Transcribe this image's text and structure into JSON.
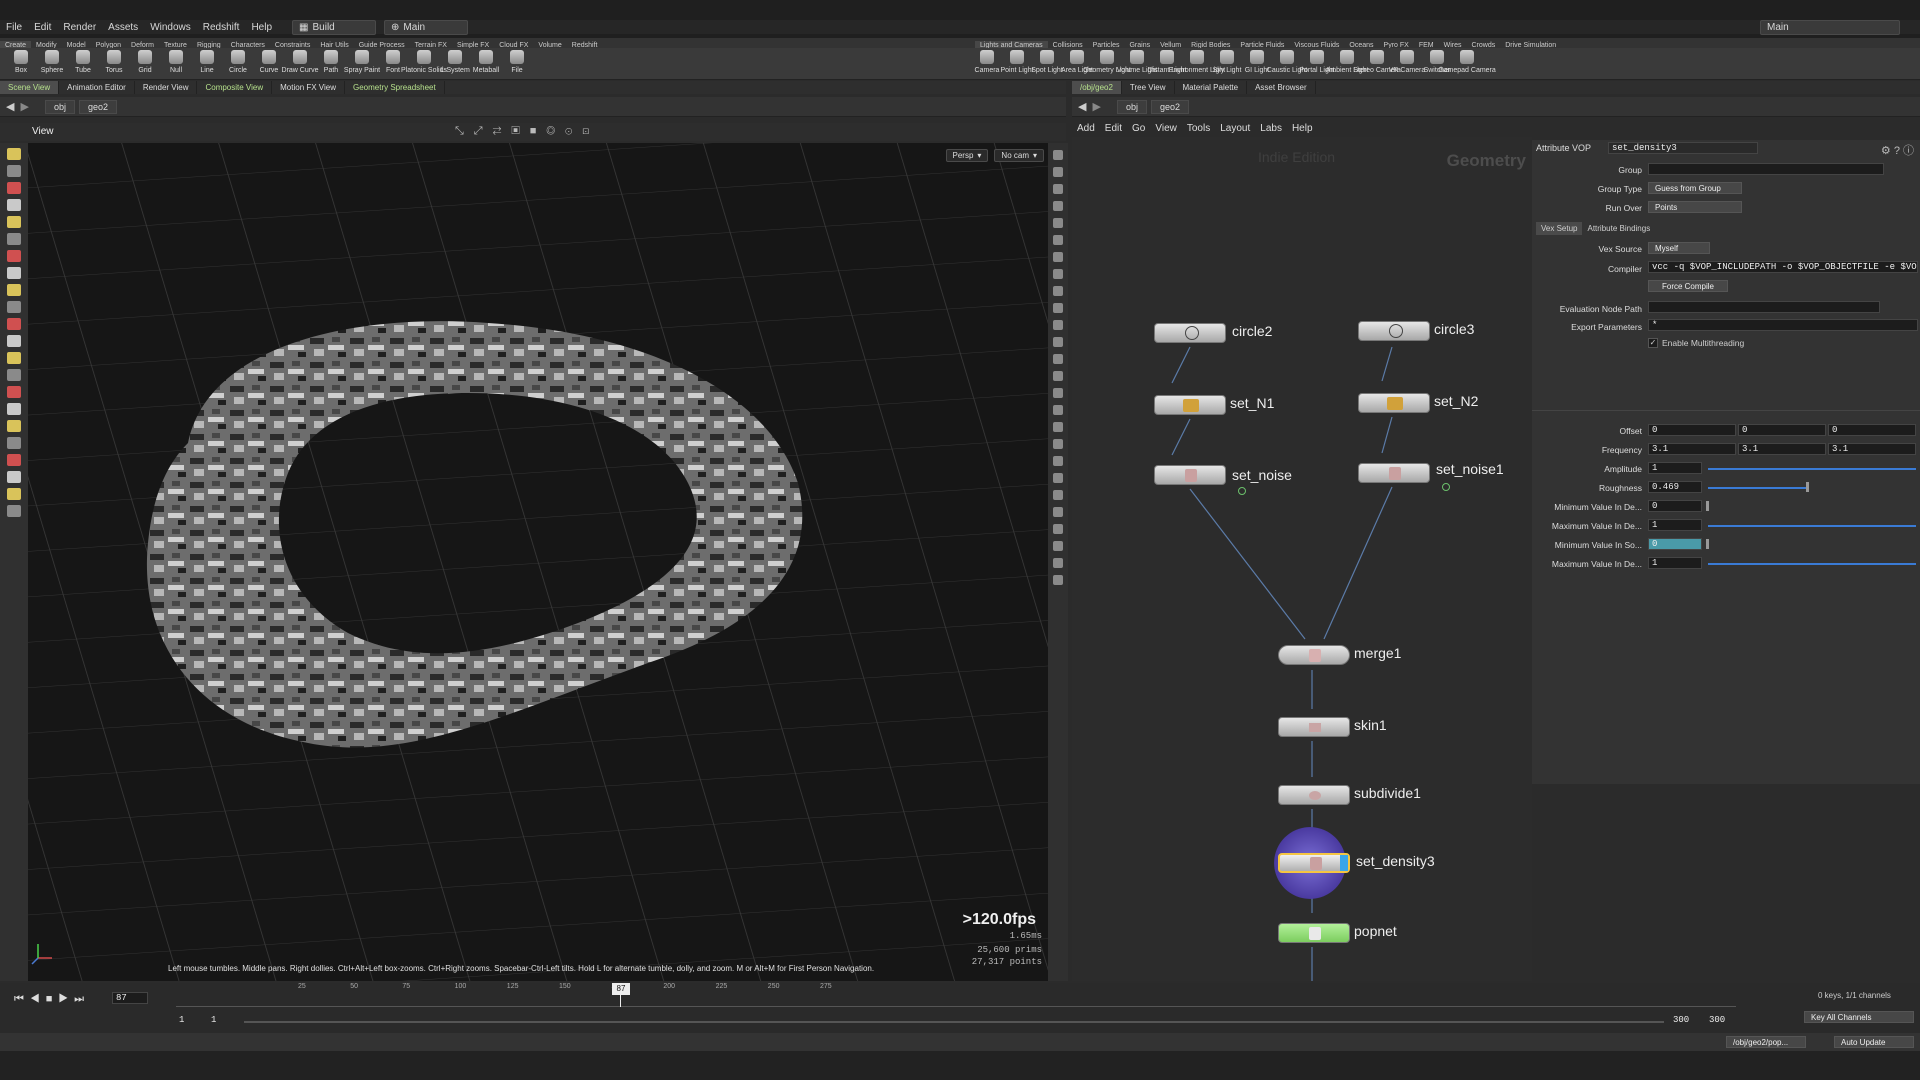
{
  "menu": {
    "items": [
      "File",
      "Edit",
      "Render",
      "Assets",
      "Windows",
      "Redshift",
      "Help"
    ],
    "desktop": "Build",
    "context": "Main",
    "main_right": "Main"
  },
  "shelf_tabs_left": [
    "Create",
    "Modify",
    "Model",
    "Polygon",
    "Deform",
    "Texture",
    "Rigging",
    "Characters",
    "Constraints",
    "Hair Utils",
    "Guide Process",
    "Terrain FX",
    "Simple FX",
    "Cloud FX",
    "Volume",
    "Redshift"
  ],
  "shelf_tabs_right": [
    "Lights and Cameras",
    "Collisions",
    "Particles",
    "Grains",
    "Vellum",
    "Rigid Bodies",
    "Particle Fluids",
    "Viscous Fluids",
    "Oceans",
    "Pyro FX",
    "FEM",
    "Wires",
    "Crowds",
    "Drive Simulation"
  ],
  "tools_left": [
    "Box",
    "Sphere",
    "Tube",
    "Torus",
    "Grid",
    "Null",
    "Line",
    "Circle",
    "Curve",
    "Draw Curve",
    "Path",
    "Spray Paint",
    "Font",
    "Platonic Solids",
    "L-System",
    "Metaball",
    "File"
  ],
  "tools_right": [
    "Camera",
    "Point Light",
    "Spot Light",
    "Area Light",
    "Geometry Light",
    "Volume Light",
    "Distant Light",
    "Environment Light",
    "Sky Light",
    "GI Light",
    "Caustic Light",
    "Portal Light",
    "Ambient Light",
    "Stereo Camera",
    "VR Camera",
    "Switcher",
    "Gamepad Camera"
  ],
  "left_pane_tabs": [
    "Scene View",
    "Animation Editor",
    "Render View",
    "Composite View",
    "Motion FX View",
    "Geometry Spreadsheet"
  ],
  "right_pane_tabs": [
    "/obj/geo2",
    "Tree View",
    "Material Palette",
    "Asset Browser"
  ],
  "left_path": [
    "obj",
    "geo2"
  ],
  "right_path": [
    "obj",
    "geo2"
  ],
  "viewport": {
    "title": "View",
    "persp": "Persp",
    "cam": "No cam",
    "fps": ">120.0fps",
    "ms": "1.65ms",
    "prims": "25,600  prims",
    "points": "27,317  points",
    "help": "Left mouse tumbles. Middle pans. Right dollies. Ctrl+Alt+Left box-zooms. Ctrl+Right zooms. Spacebar-Ctrl-Left tilts. Hold L for alternate tumble, dolly, and zoom.    M or Alt+M for First Person Navigation."
  },
  "network": {
    "menu": [
      "Add",
      "Edit",
      "Go",
      "View",
      "Tools",
      "Layout",
      "Labs",
      "Help"
    ],
    "watermark": "Indie Edition",
    "context": "Geometry",
    "nodes": {
      "circle2": "circle2",
      "circle3": "circle3",
      "set_N1": "set_N1",
      "set_N2": "set_N2",
      "set_noise": "set_noise",
      "set_noise1": "set_noise1",
      "merge1": "merge1",
      "skin1": "skin1",
      "subdivide1": "subdivide1",
      "set_density3": "set_density3",
      "popnet": "popnet"
    }
  },
  "params": {
    "node_type": "Attribute VOP",
    "node_name": "set_density3",
    "group_label": "Group",
    "group_value": "",
    "group_type_label": "Group Type",
    "group_type": "Guess from Group",
    "run_over_label": "Run Over",
    "run_over": "Points",
    "tabs": [
      "Vex Setup",
      "Attribute Bindings"
    ],
    "vex_source_label": "Vex Source",
    "vex_source": "Myself",
    "compiler_label": "Compiler",
    "compiler": "vcc -q $VOP_INCLUDEPATH -o $VOP_OBJECTFILE -e $VOF",
    "force_compile": "Force Compile",
    "eval_path_label": "Evaluation Node Path",
    "eval_path": "",
    "export_label": "Export Parameters",
    "export_value": "*",
    "multithread": "Enable Multithreading",
    "offset_label": "Offset",
    "offset": [
      "0",
      "0",
      "0"
    ],
    "frequency_label": "Frequency",
    "frequency": [
      "3.1",
      "3.1",
      "3.1"
    ],
    "amplitude_label": "Amplitude",
    "amplitude": "1",
    "roughness_label": "Roughness",
    "roughness": "0.469",
    "min_dest_label": "Minimum Value In De...",
    "min_dest": "0",
    "max_dest_label": "Maximum Value In De...",
    "max_dest": "1",
    "min_src_label": "Minimum Value In So...",
    "min_src": "0",
    "max_src_label": "Maximum Value In De...",
    "max_src": "1",
    "roughness_level": 0.469,
    "amplitude_level": 1.0
  },
  "timeline": {
    "current": "87",
    "ticks": [
      "25",
      "50",
      "75",
      "100",
      "125",
      "150",
      "175",
      "200",
      "225",
      "250",
      "275"
    ],
    "start": "1",
    "start2": "1",
    "end": "300",
    "end2": "300",
    "keys": "0 keys, 1/1 channels",
    "key_channels": "Key All Channels",
    "path": "/obj/geo2/pop...",
    "update": "Auto Update"
  },
  "colors": {
    "selected_node": "#f5c542",
    "popnet": "#8edb6e",
    "link": "#5b7ba8",
    "slider": "#3a7bd5"
  }
}
